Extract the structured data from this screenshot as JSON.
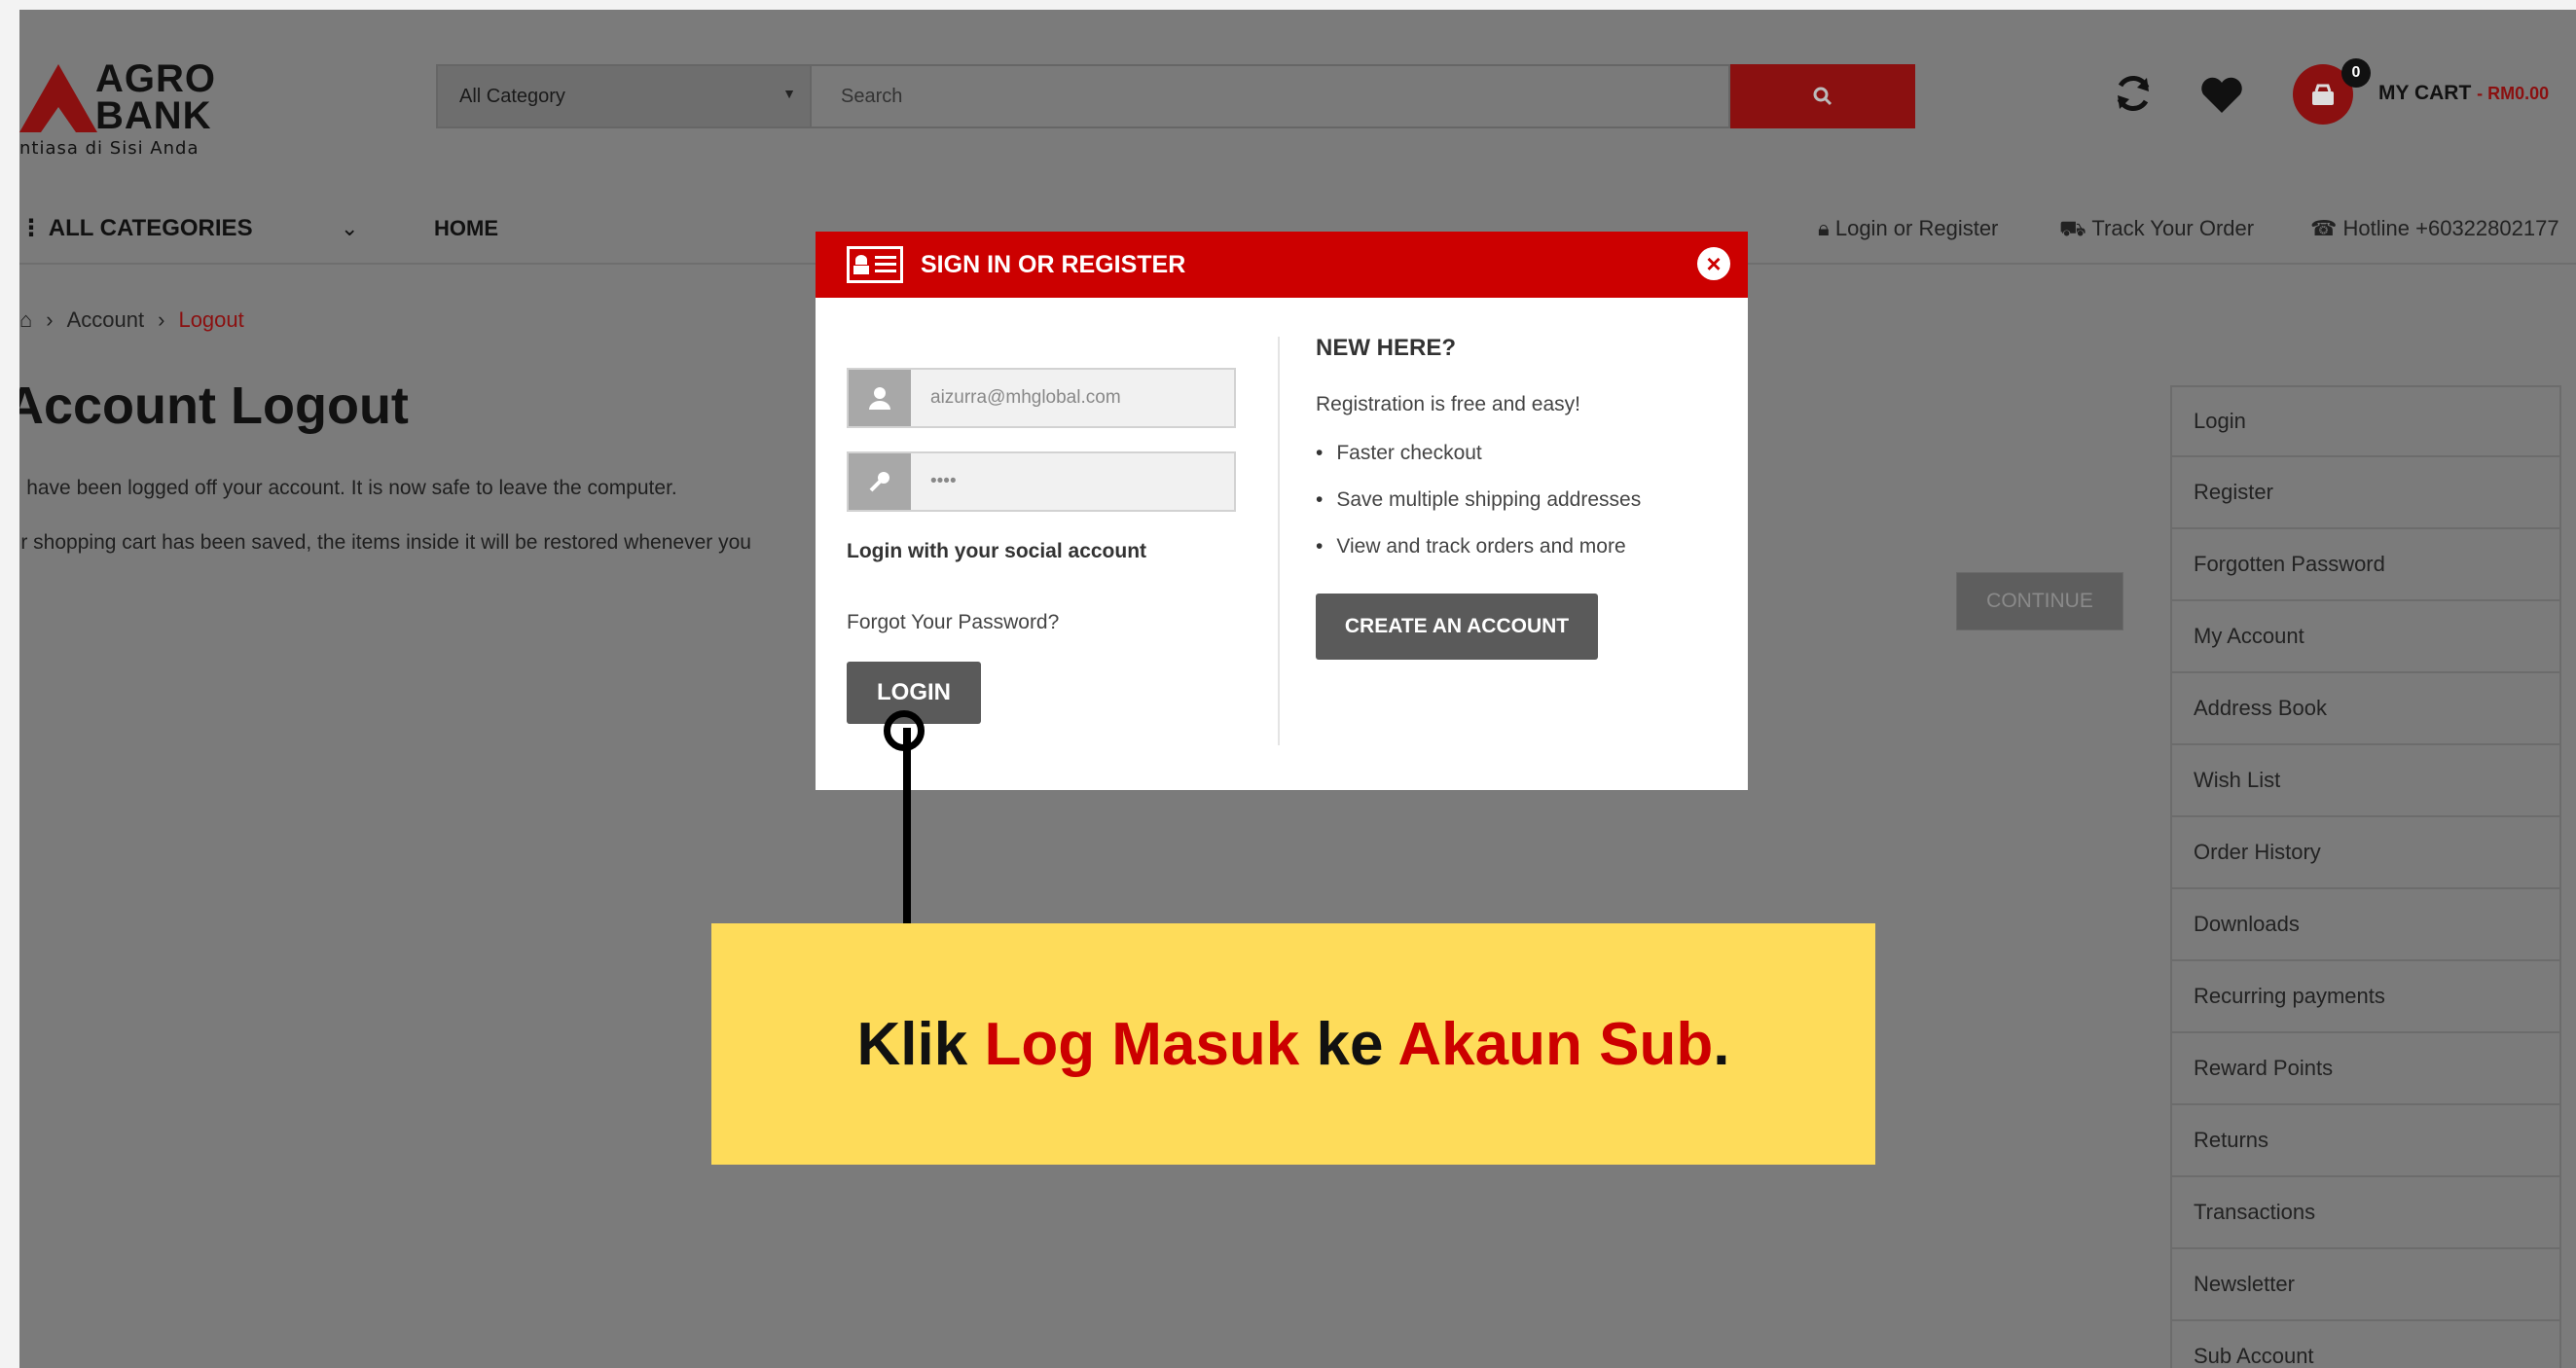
{
  "header": {
    "logo_text_line1": "AGRO",
    "logo_text_line2": "BANK",
    "logo_tagline": "ntiasa di Sisi Anda",
    "category_select": "All Category",
    "search_placeholder": "Search",
    "cart_badge": "0",
    "cart_label": "MY CART",
    "cart_amount": "- RM0.00"
  },
  "nav": {
    "all_categories": "ALL CATEGORIES",
    "home": "HOME",
    "login_register": "Login or Register",
    "track_order": "Track Your Order",
    "hotline": "Hotline +60322802177"
  },
  "breadcrumb": {
    "account": "Account",
    "current": "Logout"
  },
  "page": {
    "title": "Account Logout",
    "para1": "ou have been logged off your account. It is now safe to leave the computer.",
    "para2": "our shopping cart has been saved, the items inside it will be restored whenever you",
    "continue": "CONTINUE"
  },
  "sidebar": {
    "items": [
      "Login",
      "Register",
      "Forgotten Password",
      "My Account",
      "Address Book",
      "Wish List",
      "Order History",
      "Downloads",
      "Recurring payments",
      "Reward Points",
      "Returns",
      "Transactions",
      "Newsletter",
      "Sub Account"
    ]
  },
  "modal": {
    "title": "SIGN IN OR REGISTER",
    "email_value": "aizurra@mhglobal.com",
    "password_value": "••••",
    "social_label": "Login with your social account",
    "forgot": "Forgot Your Password?",
    "login_button": "LOGIN",
    "new_here": "NEW HERE?",
    "registration_free": "Registration is free and easy!",
    "benefits": [
      "Faster checkout",
      "Save multiple shipping addresses",
      "View and track orders and more"
    ],
    "create_account": "CREATE AN ACCOUNT",
    "header_color": "#cc0000"
  },
  "callout": {
    "part1": "Klik ",
    "part2": "Log Masuk",
    "part3": " ke ",
    "part4": "Akaun Sub",
    "part5": ".",
    "background": "#fedc5a",
    "highlight_color": "#cc0000"
  },
  "icons": [
    "refresh-icon",
    "heart-icon",
    "cart-icon",
    "search-icon",
    "lock-icon",
    "truck-icon",
    "phone-icon",
    "user-icon",
    "key-icon",
    "close-icon",
    "id-card-icon"
  ]
}
